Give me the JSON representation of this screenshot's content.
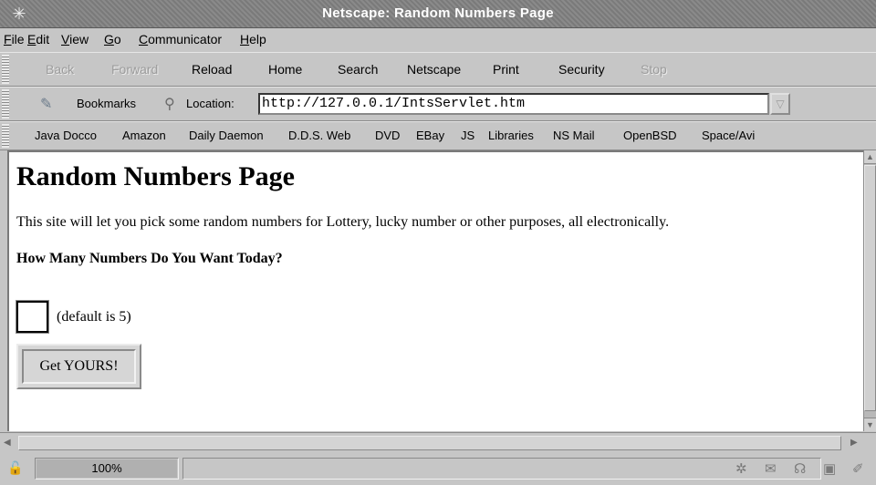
{
  "window": {
    "title": "Netscape: Random Numbers Page"
  },
  "menu": [
    {
      "label": "File",
      "accel": "F",
      "rest": "ile"
    },
    {
      "label": "Edit",
      "accel": "E",
      "rest": "dit"
    },
    {
      "label": "View",
      "accel": "V",
      "rest": "iew"
    },
    {
      "label": "Go",
      "accel": "G",
      "rest": "o"
    },
    {
      "label": "Communicator",
      "accel": "C",
      "rest": "ommunicator"
    },
    {
      "label": "Help",
      "accel": "H",
      "rest": "elp"
    }
  ],
  "navigation": {
    "back": "Back",
    "forward": "Forward",
    "reload": "Reload",
    "home": "Home",
    "search": "Search",
    "netscape": "Netscape",
    "print": "Print",
    "security": "Security",
    "stop": "Stop"
  },
  "location": {
    "bookmarks_label": "Bookmarks",
    "location_label": "Location:",
    "url": "http://127.0.0.1/IntsServlet.htm"
  },
  "personal_toolbar": [
    "Java Docco",
    "Amazon",
    "Daily Daemon",
    "D.D.S. Web",
    "DVD",
    "EBay",
    "JS",
    "Libraries",
    "NS Mail",
    "OpenBSD",
    "Space/Avi"
  ],
  "page": {
    "heading": "Random Numbers Page",
    "intro": "This site will let you pick some random numbers for Lottery, lucky number or other purposes, all electronically.",
    "question": "How Many Numbers Do You Want Today?",
    "input_value": "",
    "default_note": "(default is 5)",
    "submit_label": "Get YOURS!"
  },
  "status": {
    "progress_fraction": 1.0,
    "progress_text": "100%",
    "message": ""
  },
  "icons": {
    "window": "netscape-window-icon",
    "security": "security-lock-icon",
    "component_bar": [
      "navigator-icon",
      "mail-icon",
      "discussion-icon",
      "composer-icon",
      "edit-icon"
    ]
  }
}
